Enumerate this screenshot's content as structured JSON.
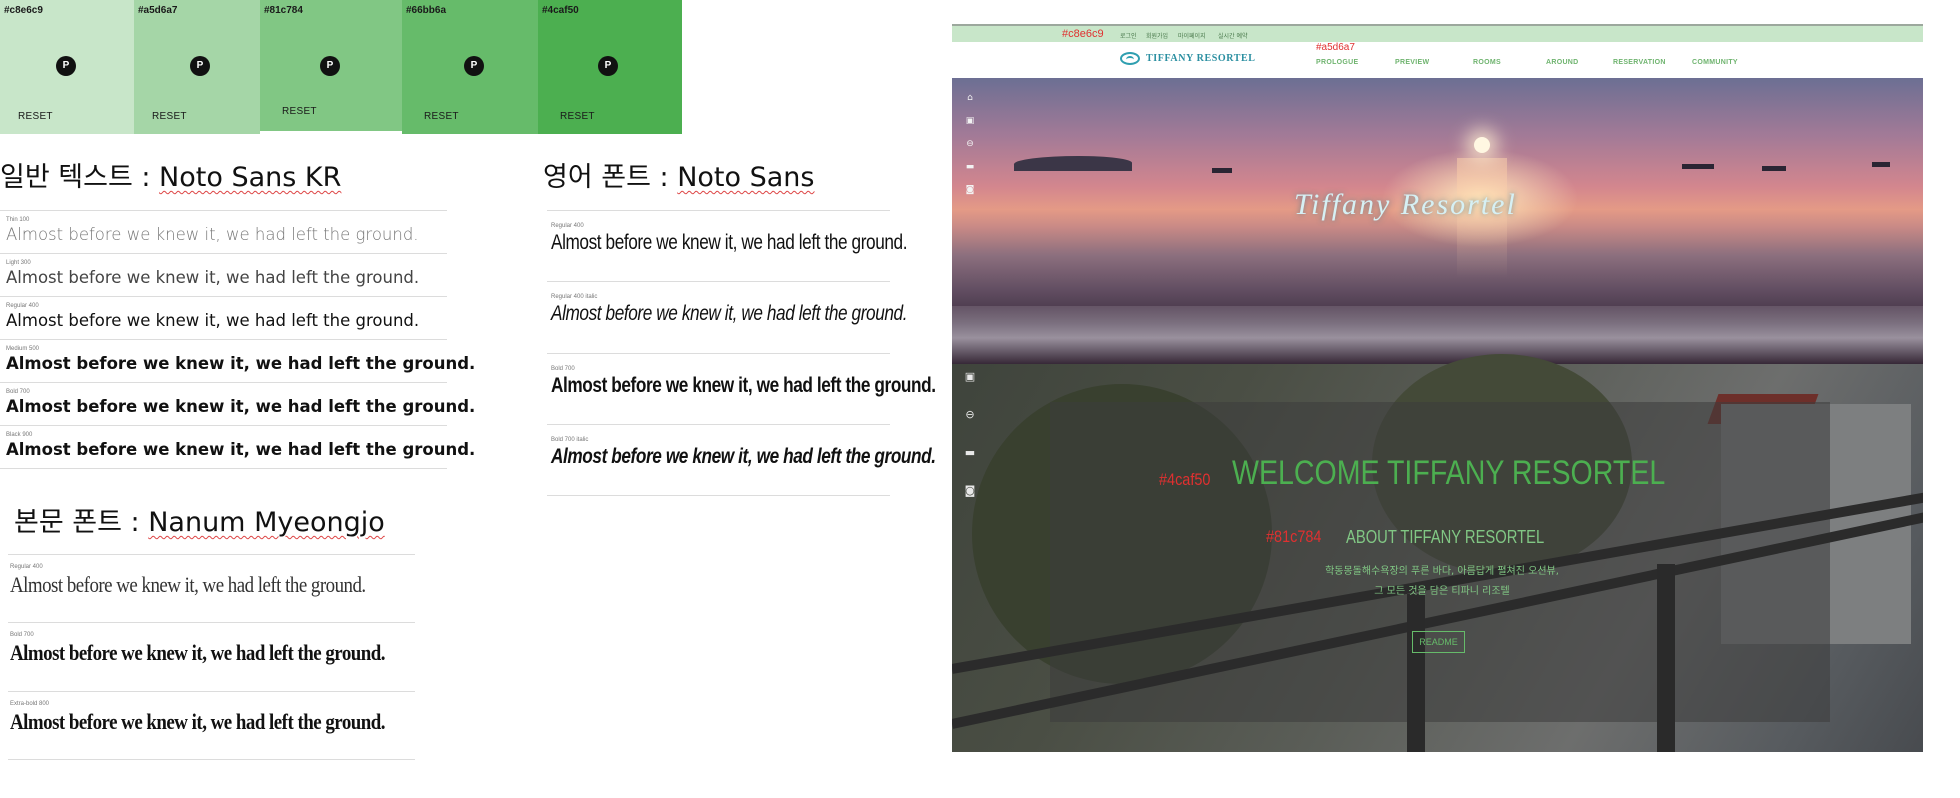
{
  "swatches": [
    {
      "hex": "#c8e6c9",
      "color": "#c8e6c9",
      "pin": "P",
      "reset": "RESET"
    },
    {
      "hex": "#a5d6a7",
      "color": "#a5d6a7",
      "pin": "P",
      "reset": "RESET"
    },
    {
      "hex": "#81c784",
      "color": "#81c784",
      "pin": "P",
      "reset": "RESET"
    },
    {
      "hex": "#66bb6a",
      "color": "#66bb6a",
      "pin": "P",
      "reset": "RESET"
    },
    {
      "hex": "#4caf50",
      "color": "#4caf50",
      "pin": "P",
      "reset": "RESET"
    }
  ],
  "sections": {
    "noto_kr": {
      "heading_prefix": "일반 텍스트 : ",
      "font_name": "Noto Sans KR",
      "samples": [
        {
          "label": "Thin 100",
          "text": "Almost before we knew it, we had left the ground."
        },
        {
          "label": "Light 300",
          "text": "Almost before we knew it, we had left the ground."
        },
        {
          "label": "Regular 400",
          "text": "Almost before we knew it, we had left the ground."
        },
        {
          "label": "Medium 500",
          "text": "Almost before we knew it, we had left the ground."
        },
        {
          "label": "Bold 700",
          "text": "Almost before we knew it, we had left the ground."
        },
        {
          "label": "Black 900",
          "text": "Almost before we knew it, we had left the ground."
        }
      ]
    },
    "noto_en": {
      "heading_prefix": "영어 폰트 :  ",
      "font_name": "Noto Sans",
      "samples": [
        {
          "label": "Regular 400",
          "text": "Almost before we knew it, we had left the ground."
        },
        {
          "label": "Regular 400 italic",
          "text": "Almost before we knew it, we had left the ground."
        },
        {
          "label": "Bold 700",
          "text": "Almost before we knew it, we had left the ground."
        },
        {
          "label": "Bold 700 italic",
          "text": "Almost before we knew it, we had left the ground."
        }
      ]
    },
    "nanum": {
      "heading_prefix": "본문 폰트 : ",
      "font_name": "Nanum Myeongjo",
      "samples": [
        {
          "label": "Regular 400",
          "text": "Almost before we knew it, we had left the ground."
        },
        {
          "label": "Bold 700",
          "text": "Almost before we knew it, we had left the ground."
        },
        {
          "label": "Extra-bold 800",
          "text": "Almost before we knew it, we had left the ground."
        }
      ]
    }
  },
  "site": {
    "topbar_note": "#c8e6c9",
    "topbar_links": [
      "로그인",
      "회원가입",
      "마이페이지",
      "실시간 예약"
    ],
    "navbar_note": "#a5d6a7",
    "logo_text": "TIFFANY RESORTEL",
    "menu": [
      "PROLOGUE",
      "PREVIEW",
      "ROOMS",
      "AROUND",
      "RESERVATION",
      "COMMUNITY"
    ],
    "hero_title": "Tiffany Resortel",
    "hero_icons": [
      "home-icon",
      "image-icon",
      "lock-icon",
      "car-icon",
      "camera-icon"
    ],
    "lower_icons": [
      "image-icon",
      "lock-icon",
      "car-icon",
      "camera-icon"
    ],
    "welcome_note": "#4caf50",
    "welcome_title": "WELCOME TIFFANY RESORTEL",
    "about_note": "#81c784",
    "about_title": "ABOUT TIFFANY RESORTEL",
    "desc_line1": "학동몽돌해수욕장의 푸른 바다, 아름답게 펼쳐진 오션뷰,",
    "desc_line2": "그 모든 것을 담은 티파니 리조텔",
    "readme": "README"
  }
}
